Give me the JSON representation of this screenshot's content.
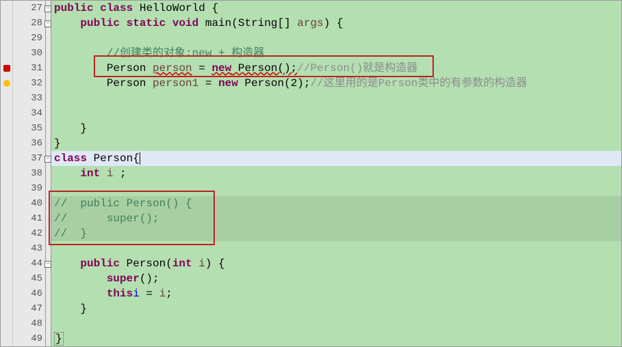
{
  "lines": {
    "27": "27",
    "28": "28",
    "29": "29",
    "30": "30",
    "31": "31",
    "32": "32",
    "33": "33",
    "34": "34",
    "35": "35",
    "36": "36",
    "37": "37",
    "38": "38",
    "39": "39",
    "40": "40",
    "41": "41",
    "42": "42",
    "43": "43",
    "44": "44",
    "45": "45",
    "46": "46",
    "47": "47",
    "48": "48",
    "49": "49"
  },
  "code": {
    "l27": {
      "kw1": "public",
      "kw2": "class",
      "cls": " HelloWorld ",
      "brace": "{"
    },
    "l28": {
      "indent": "    ",
      "kw1": "public",
      "kw2": "static",
      "kw3": "void",
      "method": " main(String[] ",
      "arg": "args",
      ") {": ") {"
    },
    "l30": {
      "indent": "        ",
      "cmt": "//创建类的对象:new + 构造器"
    },
    "l31": {
      "indent": "        ",
      "cls": "Person ",
      "var": "person",
      "eq": " = ",
      "kw": "new",
      "ctor": " Person();",
      "cmt": "//Person()就是构造器"
    },
    "l32": {
      "indent": "        ",
      "cls": "Person ",
      "var": "person1",
      "eq": " = ",
      "kw": "new",
      "ctor": " Person(",
      "num": "2",
      ");": ");",
      "cmt": "//这里用的是Person类中的有参数的构造器"
    },
    "l35": {
      "indent": "    ",
      "brace": "}"
    },
    "l36": {
      "brace": "}"
    },
    "l37": {
      "kw": "class",
      "cls": " Person",
      "brace": "{"
    },
    "l38": {
      "indent": "    ",
      "kw": "int",
      "var": " i",
      ";": " ;"
    },
    "l40": {
      "cmt": "//  public Person() {"
    },
    "l41": {
      "cmt": "//      super();"
    },
    "l42": {
      "cmt": "//  }"
    },
    "l44": {
      "indent": "    ",
      "kw": "public",
      "cls": " Person(",
      "kw2": "int",
      "arg": " i",
      ") {": ") {"
    },
    "l45": {
      "indent": "        ",
      "kw": "super",
      "rest": "();"
    },
    "l46": {
      "indent": "        ",
      "kw": "this",
      ".i": ".",
      "fld": "i",
      "eq": " = ",
      "var": "i",
      ";": ";"
    },
    "l47": {
      "indent": "    ",
      "brace": "}"
    },
    "l49": {
      "brace": "}"
    }
  },
  "fold_minus": "−"
}
